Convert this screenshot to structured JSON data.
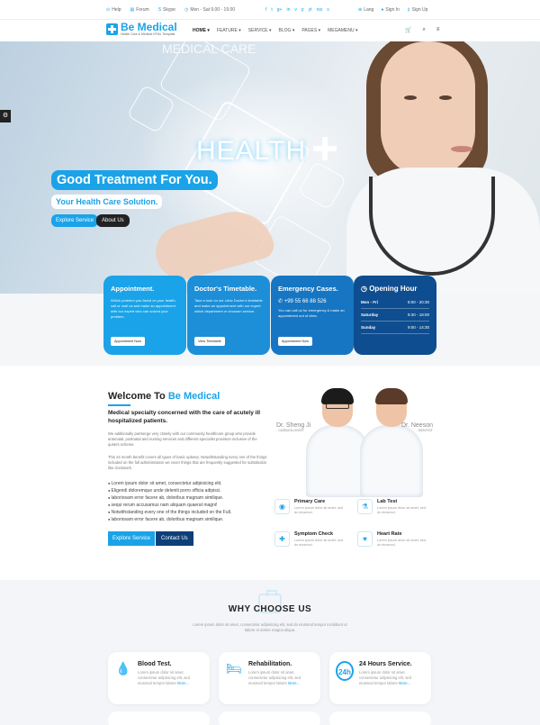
{
  "topbar": {
    "help": "Help",
    "forum": "Forum",
    "skype": "Skype",
    "hours": "Mon - Sat 9.00 - 19.00",
    "lang": "Lang",
    "signin": "Sign In",
    "signup": "Sign Up",
    "social": [
      "f",
      "t",
      "g+",
      "in",
      "v",
      "p",
      "yt",
      "rss",
      "s"
    ]
  },
  "brand": {
    "name": "Be Medical",
    "tagline": "Health Care & Medical HTML Template"
  },
  "nav": {
    "items": [
      "HOME ▾",
      "FEATURE ▾",
      "SERVICE ▾",
      "BLOG ▾",
      "PAGES ▾",
      "MEGAMENU ▾"
    ]
  },
  "hero": {
    "bg_text": "MEDICAL CARE",
    "health_word": "HEALTH",
    "title": "Good Treatment For You.",
    "subtitle": "Your Health Care Solution.",
    "btn_explore": "Explore Service",
    "btn_about": "About Us"
  },
  "info": {
    "appointment": {
      "title": "Appointment.",
      "text": "Which problem you faced on your health, call or mail us and make an appointment with our expert who can solved your problem.",
      "button": "Appointment Now"
    },
    "timetable": {
      "title": "Doctor's Timetable.",
      "text": "Take a look on our clinic Doctor's timetable and make an appointment with our expert which department or choosen service.",
      "button": "View Timetable"
    },
    "emergency": {
      "title": "Emergency Cases.",
      "phone": "+99 55 66 88 526",
      "text": "You can call us for emergency & make an appointment out of clinic.",
      "button": "Appointment Now"
    },
    "hours": {
      "title": "Opening Hour",
      "rows": [
        [
          "Mon - Fri",
          "8:00 - 20:30"
        ],
        [
          "Saturday",
          "8:30 - 18:00"
        ],
        [
          "Sunday",
          "9:00 - 14:30"
        ]
      ]
    }
  },
  "welcome": {
    "title_a": "Welcome To ",
    "title_b": "Be Medical",
    "subtitle": "Medical specialty concerned with the care of acutely ill hospitalized patients.",
    "p1": "We additionally partnerge very closely with our community healthcare group who provide antenatal, postnatal and nursing services and different specialist provision inclusive of the quiters scheme.",
    "p2": "This 24 month benefit covers all types of basic upkeep. Notwithstanding every one of the things included on the full administration we cover things that are frequently suggested for substitution like clockwork.",
    "list": [
      "Lorem ipsum dolor sit amet, consectetur adipisicing elit.",
      "Eligendi doloremque unde deleniti porro officia adipisci.",
      "laboriosam error facere ab, doloribus magnam similique.",
      "sequi rerum accusamus nam aliquam quaerat magni!",
      "Notwithstanding every one of the things included on the Full.",
      "laboriosam error facere ab, doloribus magnam similique."
    ],
    "btn_explore": "Explore Service",
    "btn_contact": "Contact Us",
    "doctor1": {
      "name": "Dr. Sheng Ji",
      "role": "- CARDIOLOGIST"
    },
    "doctor2": {
      "name": "Dr. Neeson",
      "role": "- DENTIST"
    },
    "features": [
      {
        "title": "Primary Care",
        "text": "Lorem ipsum dolor sit amet, sed do eiusmod."
      },
      {
        "title": "Lab Test",
        "text": "Lorem ipsum dolor sit amet, sed do eiusmod."
      },
      {
        "title": "Symptom Check",
        "text": "Lorem ipsum dolor sit amet, sed do eiusmod."
      },
      {
        "title": "Heart Rate",
        "text": "Lorem ipsum dolor sit amet, sed do eiusmod."
      }
    ]
  },
  "why": {
    "title": "WHY CHOOSE US",
    "desc": "Lorem ipsum dolor sit amet, consectetur adipisicing elit, sed do eiusmod tempor incididunt ut labore et dolore magna aliqua.",
    "cards": [
      {
        "title": "Blood Test.",
        "text": "Lorem ipsum dolor sit amet, consectetur adipisicing elit, sed eiusmod tempor labore ",
        "more": "More..."
      },
      {
        "title": "Rehabilitation.",
        "text": "Lorem ipsum dolor sit amet, consectetur adipisicing elit, sed eiusmod tempor labore ",
        "more": "More..."
      },
      {
        "title": "24 Hours Service.",
        "text": "Lorem ipsum dolor sit amet, consectetur adipisicing elit, sed eiusmod tempor labore ",
        "more": "More..."
      }
    ],
    "card_icon_text": "24h"
  },
  "colors": {
    "accent": "#1aa3e8",
    "dark_blue": "#0e4d8f"
  }
}
